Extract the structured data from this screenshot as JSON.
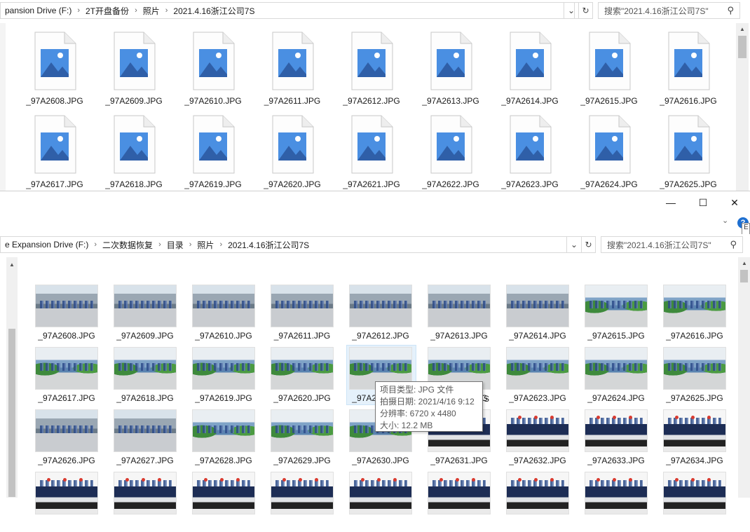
{
  "top_window": {
    "address": {
      "crumbs": [
        "pansion Drive (F:)",
        "2T开盘备份",
        "照片",
        "2021.4.16浙江公司7S"
      ],
      "dropdown_icon": "chevron-down-icon",
      "refresh_icon": "refresh-icon"
    },
    "search": {
      "placeholder": "搜索\"2021.4.16浙江公司7S\""
    },
    "files": [
      "_97A2608.JPG",
      "_97A2609.JPG",
      "_97A2610.JPG",
      "_97A2611.JPG",
      "_97A2612.JPG",
      "_97A2613.JPG",
      "_97A2614.JPG",
      "_97A2615.JPG",
      "_97A2616.JPG",
      "_97A2617.JPG",
      "_97A2618.JPG",
      "_97A2619.JPG",
      "_97A2620.JPG",
      "_97A2621.JPG",
      "_97A2622.JPG",
      "_97A2623.JPG",
      "_97A2624.JPG",
      "_97A2625.JPG"
    ]
  },
  "bottom_window": {
    "window_controls": {
      "minimize": "—",
      "maximize": "☐",
      "close": "✕"
    },
    "help_tip": "E",
    "address": {
      "crumbs": [
        "e Expansion Drive (F:)",
        "二次数据恢复",
        "目录",
        "照片",
        "2021.4.16浙江公司7S"
      ]
    },
    "search": {
      "placeholder": "搜索\"2021.4.16浙江公司7S\""
    },
    "files": [
      {
        "name": "_97A2608.JPG",
        "kind": "outdoor"
      },
      {
        "name": "_97A2609.JPG",
        "kind": "outdoor"
      },
      {
        "name": "_97A2610.JPG",
        "kind": "outdoor"
      },
      {
        "name": "_97A2611.JPG",
        "kind": "outdoor"
      },
      {
        "name": "_97A2612.JPG",
        "kind": "outdoor"
      },
      {
        "name": "_97A2613.JPG",
        "kind": "outdoor"
      },
      {
        "name": "_97A2614.JPG",
        "kind": "outdoor"
      },
      {
        "name": "_97A2615.JPG",
        "kind": "green"
      },
      {
        "name": "_97A2616.JPG",
        "kind": "green"
      },
      {
        "name": "_97A2617.JPG",
        "kind": "green"
      },
      {
        "name": "_97A2618.JPG",
        "kind": "green"
      },
      {
        "name": "_97A2619.JPG",
        "kind": "green"
      },
      {
        "name": "_97A2620.JPG",
        "kind": "green"
      },
      {
        "name": "_97A2621.JPG",
        "kind": "green"
      },
      {
        "name": "_97A2622.JPG",
        "kind": "green"
      },
      {
        "name": "_97A2623.JPG",
        "kind": "green"
      },
      {
        "name": "_97A2624.JPG",
        "kind": "green"
      },
      {
        "name": "_97A2625.JPG",
        "kind": "green"
      },
      {
        "name": "_97A2626.JPG",
        "kind": "outdoor"
      },
      {
        "name": "_97A2627.JPG",
        "kind": "outdoor"
      },
      {
        "name": "_97A2628.JPG",
        "kind": "green"
      },
      {
        "name": "_97A2629.JPG",
        "kind": "green"
      },
      {
        "name": "_97A2630.JPG",
        "kind": "green"
      },
      {
        "name": "_97A2631.JPG",
        "kind": "indoor"
      },
      {
        "name": "_97A2632.JPG",
        "kind": "indoor"
      },
      {
        "name": "_97A2633.JPG",
        "kind": "indoor"
      },
      {
        "name": "_97A2634.JPG",
        "kind": "indoor"
      },
      {
        "name": "",
        "kind": "indoor"
      },
      {
        "name": "",
        "kind": "indoor"
      },
      {
        "name": "",
        "kind": "indoor"
      },
      {
        "name": "",
        "kind": "indoor"
      },
      {
        "name": "",
        "kind": "indoor"
      },
      {
        "name": "",
        "kind": "indoor"
      },
      {
        "name": "",
        "kind": "indoor"
      },
      {
        "name": "",
        "kind": "indoor"
      },
      {
        "name": "",
        "kind": "indoor"
      }
    ],
    "tooltip": {
      "type_label": "项目类型: JPG 文件",
      "date_label": "拍摄日期: 2021/4/16 9:12",
      "resolution_label": "分辨率: 6720 x 4480",
      "size_label": "大小: 12.2 MB"
    },
    "hidden_tail": "S"
  },
  "colors": {
    "image_icon_blue": "#4a8fe2",
    "icon_mountain": "#2f5fa8",
    "accent": "#1e6fd0"
  }
}
